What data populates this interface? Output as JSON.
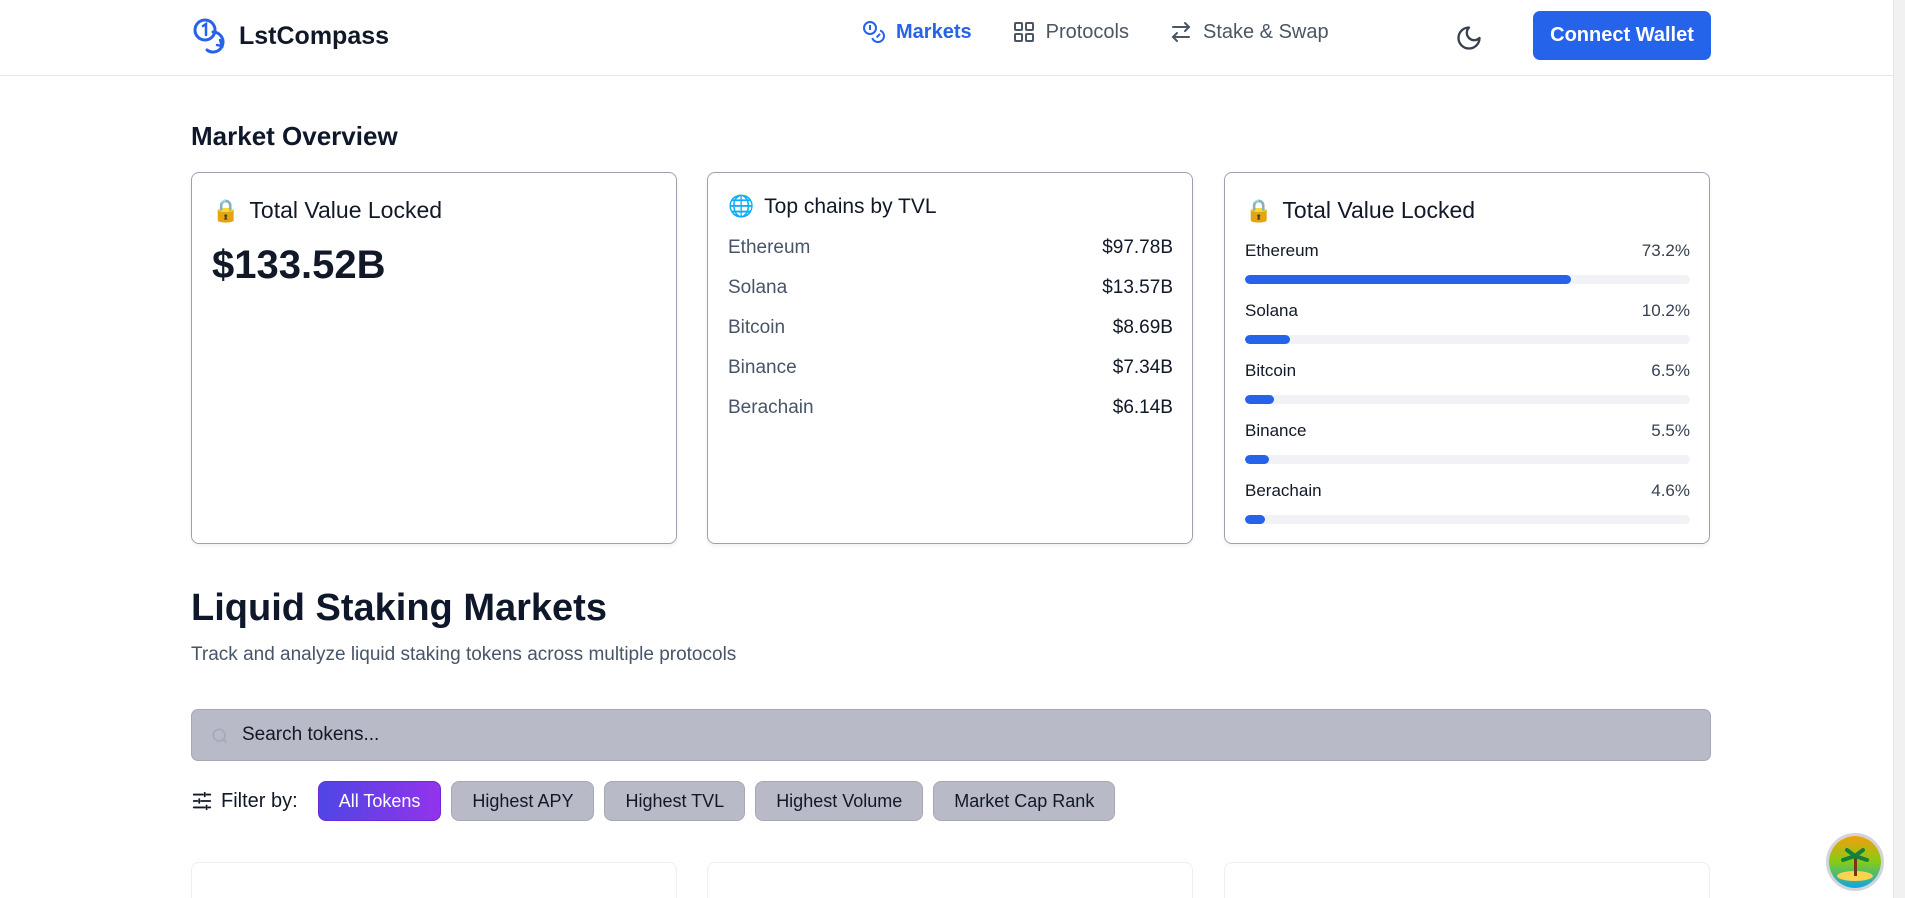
{
  "header": {
    "brand": "LstCompass",
    "nav": [
      {
        "label": "Markets",
        "icon": "coins-icon",
        "active": true
      },
      {
        "label": "Protocols",
        "icon": "grid-icon",
        "active": false
      },
      {
        "label": "Stake & Swap",
        "icon": "swap-arrows-icon",
        "active": false
      }
    ],
    "connect_label": "Connect Wallet"
  },
  "overview": {
    "title": "Market Overview",
    "tvl_card": {
      "title": "Total Value Locked",
      "value": "$133.52B",
      "icon": "lock-icon"
    },
    "chains_card": {
      "title": "Top chains by TVL",
      "icon": "globe-icon",
      "rows": [
        {
          "name": "Ethereum",
          "value": "$97.78B"
        },
        {
          "name": "Solana",
          "value": "$13.57B"
        },
        {
          "name": "Bitcoin",
          "value": "$8.69B"
        },
        {
          "name": "Binance",
          "value": "$7.34B"
        },
        {
          "name": "Berachain",
          "value": "$6.14B"
        }
      ]
    },
    "share_card": {
      "title": "Total Value Locked",
      "icon": "lock-icon",
      "rows": [
        {
          "name": "Ethereum",
          "pct_label": "73.2%",
          "fraction": 0.732
        },
        {
          "name": "Solana",
          "pct_label": "10.2%",
          "fraction": 0.102
        },
        {
          "name": "Bitcoin",
          "pct_label": "6.5%",
          "fraction": 0.065
        },
        {
          "name": "Binance",
          "pct_label": "5.5%",
          "fraction": 0.055
        },
        {
          "name": "Berachain",
          "pct_label": "4.6%",
          "fraction": 0.046
        }
      ]
    }
  },
  "markets": {
    "title": "Liquid Staking Markets",
    "subtitle": "Track and analyze liquid staking tokens across multiple protocols",
    "search_placeholder": "Search tokens...",
    "filter_label": "Filter by:",
    "filters": [
      {
        "label": "All Tokens",
        "active": true
      },
      {
        "label": "Highest APY",
        "active": false
      },
      {
        "label": "Highest TVL",
        "active": false
      },
      {
        "label": "Highest Volume",
        "active": false
      },
      {
        "label": "Market Cap Rank",
        "active": false
      }
    ]
  },
  "colors": {
    "accent": "#2563eb",
    "chip_gradient_start": "#4f46e5",
    "chip_gradient_end": "#9333ea"
  }
}
